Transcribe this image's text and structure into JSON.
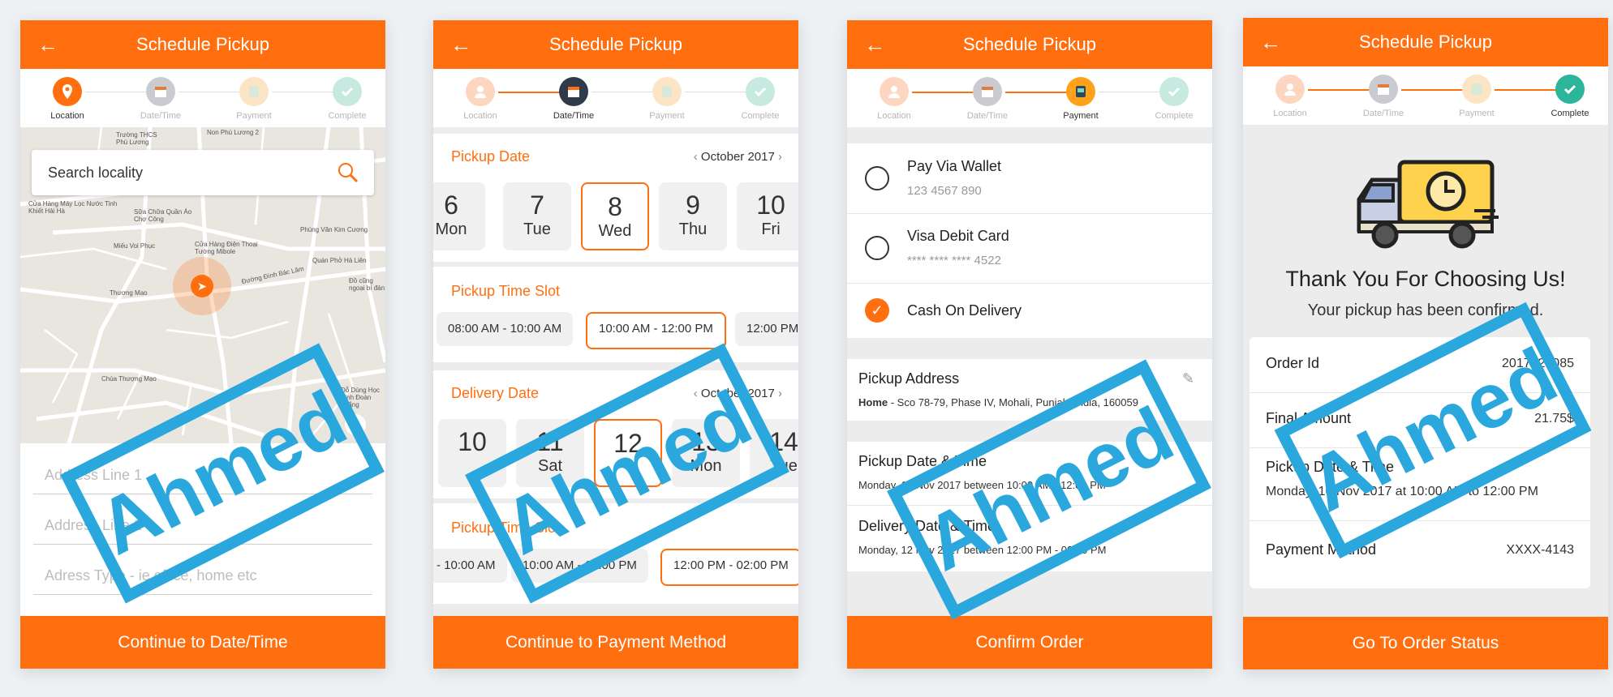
{
  "common": {
    "title": "Schedule Pickup",
    "back_icon": "arrow-left-icon",
    "steps": [
      "Location",
      "Date/Time",
      "Payment",
      "Complete"
    ]
  },
  "screen1": {
    "search_placeholder": "Search locality",
    "map_labels": [
      "Trường THCS Phù Lương",
      "Non Phù Lương 2",
      "Cửa Hàng Máy Lọc Nước Tinh Khiết Hải Hà",
      "Sữa Chữa Quần Áo Chợ Công",
      "Cửa Hàng Điện Thoại Tường Mibole",
      "Miếu Voi Phục",
      "Phùng Văn Kim Cương",
      "Quán Phở Hà Liên",
      "Đường Đình Bác Lâm",
      "Đồ cũng ngoại bí đản",
      "Thương Mao",
      "Chùa Thượng Mạo",
      "Đỗ Dùng Học Sinh Đoàn Thắng"
    ],
    "fields": [
      "Address Line 1",
      "Address Line 2",
      "Adress Type - ie office, home etc"
    ],
    "button": "Continue to Date/Time"
  },
  "screen2": {
    "pickup_date_title": "Pickup Date",
    "month": "October 2017",
    "pickup_dates": [
      {
        "day": "6",
        "weekday": "Mon"
      },
      {
        "day": "7",
        "weekday": "Tue"
      },
      {
        "day": "8",
        "weekday": "Wed"
      },
      {
        "day": "9",
        "weekday": "Thu"
      },
      {
        "day": "10",
        "weekday": "Fri"
      }
    ],
    "pickup_slot_title": "Pickup Time Slot",
    "pickup_slots": [
      "08:00 AM - 10:00 AM",
      "10:00 AM - 12:00 PM",
      "12:00 PM"
    ],
    "delivery_date_title": "Delivery Date",
    "delivery_month": "October 2017",
    "delivery_dates": [
      {
        "day": "10",
        "weekday": ""
      },
      {
        "day": "11",
        "weekday": "Sat"
      },
      {
        "day": "12",
        "weekday": ""
      },
      {
        "day": "13",
        "weekday": "Mon"
      },
      {
        "day": "14",
        "weekday": "Tue"
      }
    ],
    "delivery_slot_title": "Pickup Time Slot",
    "delivery_slots": [
      "- 10:00 AM",
      "10:00 AM - 12:00 PM",
      "12:00 PM - 02:00 PM"
    ],
    "button": "Continue to Payment Method"
  },
  "screen3": {
    "payment_options": [
      {
        "label": "Pay Via Wallet",
        "sub": "123 4567 890"
      },
      {
        "label": "Visa Debit Card",
        "sub": "**** **** **** 4522"
      },
      {
        "label": "Cash On Delivery",
        "sub": ""
      }
    ],
    "pickup_address_title": "Pickup Address",
    "pickup_address_bold": "Home",
    "pickup_address": " - Sco 78-79, Phase IV, Mohali, Punjab, India, 160059",
    "pickup_dt_title": "Pickup Date & Time",
    "pickup_dt": "Monday, 10 Nov 2017 between 10:00 AM - 12:00 PM",
    "delivery_dt_title": "Delivery Date & Time",
    "delivery_dt": "Monday, 12 Nov 2017 between 12:00 PM - 02:00 PM",
    "button": "Confirm Order"
  },
  "screen4": {
    "thanks": "Thank You For Choosing Us!",
    "confirmed": "Your pickup has been confirmed.",
    "order_id_label": "Order Id",
    "order_id_value": "2017121085",
    "amount_label": "Final Amount",
    "amount_value": "21.75$",
    "pickup_label": "Pickup Date & Time",
    "pickup_value": "Monday, 10 Nov 2017 at 10:00 AM to 12:00 PM",
    "payment_label": "Payment Method",
    "payment_value": "XXXX-4143",
    "button": "Go To Order Status"
  },
  "watermark": "Ahmed",
  "colors": {
    "primary": "#ff6f0f",
    "stamp": "#2aa7dd"
  }
}
